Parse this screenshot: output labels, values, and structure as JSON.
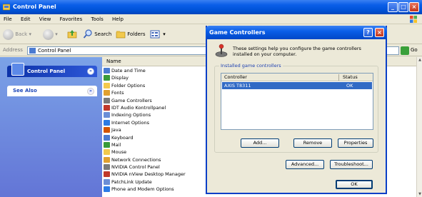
{
  "window": {
    "title": "Control Panel"
  },
  "menu": [
    "File",
    "Edit",
    "View",
    "Favorites",
    "Tools",
    "Help"
  ],
  "toolbar": {
    "back_label": "Back",
    "search_label": "Search",
    "folders_label": "Folders"
  },
  "address": {
    "label": "Address",
    "value": "Control Panel",
    "go_label": "Go"
  },
  "sidebar": {
    "control_panel_label": "Control Panel",
    "see_also_label": "See Also"
  },
  "main": {
    "column_name": "Name",
    "items": [
      "Date and Time",
      "Display",
      "Folder Options",
      "Fonts",
      "Game Controllers",
      "IDT Audio Kontrollpanel",
      "Indexing Options",
      "Internet Options",
      "Java",
      "Keyboard",
      "Mail",
      "Mouse",
      "Network Connections",
      "NVIDIA Control Panel",
      "NVIDIA nView Desktop Manager",
      "PatchLink Update",
      "Phone and Modem Options"
    ]
  },
  "dialog": {
    "title": "Game Controllers",
    "description": "These settings help you configure the game controllers installed on your computer.",
    "group_label": "Installed game controllers",
    "col_controller": "Controller",
    "col_status": "Status",
    "rows": [
      {
        "controller": "AXIS T8311",
        "status": "OK"
      }
    ],
    "buttons": {
      "add": "Add...",
      "remove": "Remove",
      "properties": "Properties",
      "advanced": "Advanced...",
      "troubleshoot": "Troubleshoot...",
      "ok": "OK"
    }
  }
}
